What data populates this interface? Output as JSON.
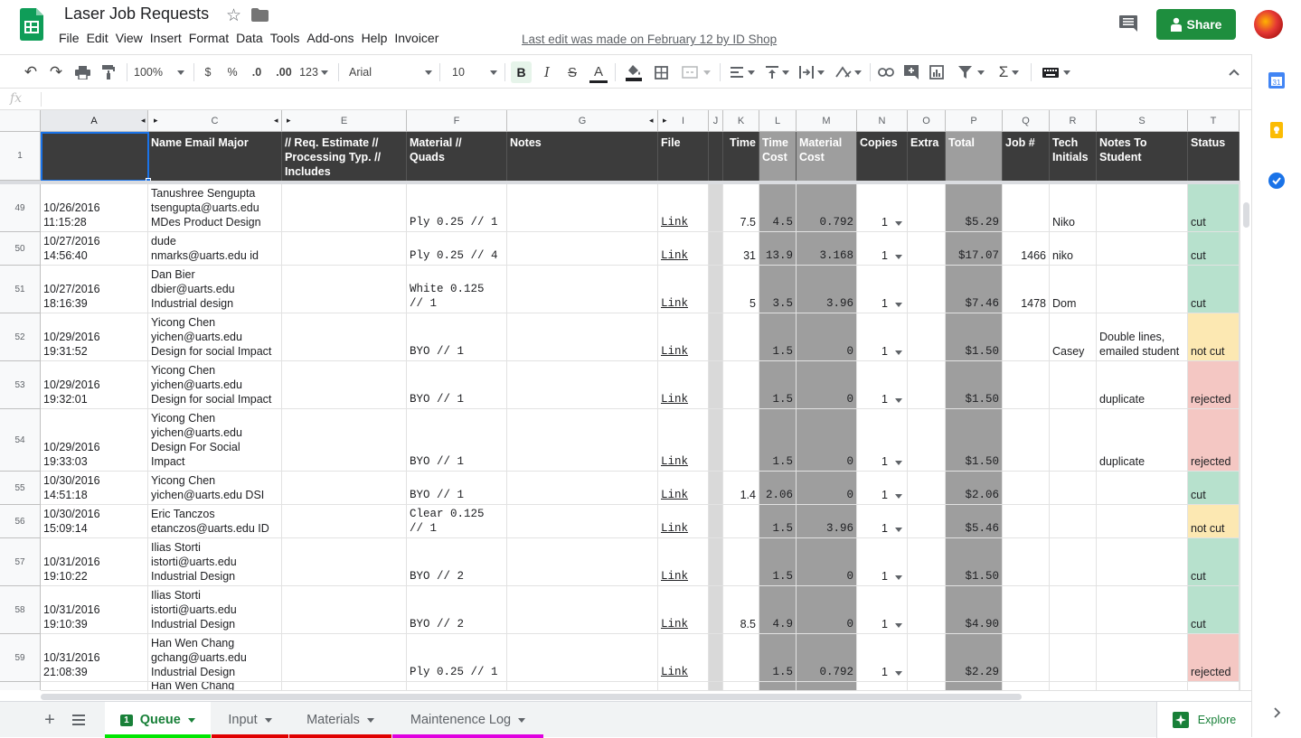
{
  "app": {
    "title": "Laser Job Requests",
    "last_edit": "Last edit was made on February 12 by ID Shop",
    "share_label": "Share",
    "accent": "#1e8e3e"
  },
  "menu": [
    "File",
    "Edit",
    "View",
    "Insert",
    "Format",
    "Data",
    "Tools",
    "Add-ons",
    "Help",
    "Invoicer"
  ],
  "toolbar": {
    "zoom": "100%",
    "currency": "$",
    "percent": "%",
    "dec_less": ".0",
    "dec_more": ".00",
    "more_formats": "123",
    "font": "Arial",
    "font_size": "10",
    "bold": "B",
    "italic": "I",
    "strike": "S",
    "text_color": "A"
  },
  "formula_bar": {
    "fx": "fx"
  },
  "columns": [
    {
      "letter": "A",
      "header": ""
    },
    {
      "letter": "C",
      "header": "Name Email Major"
    },
    {
      "letter": "E",
      "header": "// Req. Estimate //\nProcessing Typ. //\nIncludes"
    },
    {
      "letter": "F",
      "header": "Material //\nQuads"
    },
    {
      "letter": "G",
      "header": "Notes"
    },
    {
      "letter": "I",
      "header": "File"
    },
    {
      "letter": "J",
      "header": ""
    },
    {
      "letter": "K",
      "header": "Time"
    },
    {
      "letter": "L",
      "header": "Time\nCost"
    },
    {
      "letter": "M",
      "header": "Material\nCost"
    },
    {
      "letter": "N",
      "header": "Copies"
    },
    {
      "letter": "O",
      "header": "Extra"
    },
    {
      "letter": "P",
      "header": "Total"
    },
    {
      "letter": "Q",
      "header": "Job #"
    },
    {
      "letter": "R",
      "header": "Tech\nInitials"
    },
    {
      "letter": "S",
      "header": "Notes To\nStudent"
    },
    {
      "letter": "T",
      "header": "Status"
    }
  ],
  "header_row_number": "1",
  "rows": [
    {
      "num": "49",
      "date": "10/26/2016 11:15:28",
      "name": "Tanushree Sengupta\ntsengupta@uarts.edu\nMDes Product Design",
      "material": "Ply 0.25 // 1",
      "file": "Link",
      "time": "7.5",
      "time_cost": "4.5",
      "mat_cost": "0.792",
      "copies": "1",
      "total": "$5.29",
      "job": "",
      "tech": "Niko",
      "notes": "",
      "status": "cut"
    },
    {
      "num": "50",
      "date": "10/27/2016 14:56:40",
      "name": "dude\nnmarks@uarts.edu id",
      "material": "Ply 0.25 // 4",
      "file": "Link",
      "time": "31",
      "time_cost": "13.9",
      "mat_cost": "3.168",
      "copies": "1",
      "total": "$17.07",
      "job": "1466",
      "tech": "niko",
      "notes": "",
      "status": "cut"
    },
    {
      "num": "51",
      "date": "10/27/2016 18:16:39",
      "name": "Dan Bier\ndbier@uarts.edu\nIndustrial design",
      "material": "White 0.125 // 1",
      "file": "Link",
      "time": "5",
      "time_cost": "3.5",
      "mat_cost": "3.96",
      "copies": "1",
      "total": "$7.46",
      "job": "1478",
      "tech": "Dom",
      "notes": "",
      "status": "cut"
    },
    {
      "num": "52",
      "date": "10/29/2016 19:31:52",
      "name": "Yicong Chen\nyichen@uarts.edu\nDesign for social Impact",
      "material": "BYO // 1",
      "file": "Link",
      "time": "",
      "time_cost": "1.5",
      "mat_cost": "0",
      "copies": "1",
      "total": "$1.50",
      "job": "",
      "tech": "Casey",
      "notes": "Double lines,\nemailed student",
      "status": "not cut"
    },
    {
      "num": "53",
      "date": "10/29/2016 19:32:01",
      "name": "Yicong Chen\nyichen@uarts.edu\nDesign for social Impact",
      "material": "BYO // 1",
      "file": "Link",
      "time": "",
      "time_cost": "1.5",
      "mat_cost": "0",
      "copies": "1",
      "total": "$1.50",
      "job": "",
      "tech": "",
      "notes": "duplicate",
      "status": "rejected"
    },
    {
      "num": "54",
      "date": "10/29/2016 19:33:03",
      "name": "Yicong  Chen\nyichen@uarts.edu\nDesign For Social\nImpact",
      "material": "BYO // 1",
      "file": "Link",
      "time": "",
      "time_cost": "1.5",
      "mat_cost": "0",
      "copies": "1",
      "total": "$1.50",
      "job": "",
      "tech": "",
      "notes": "duplicate",
      "status": "rejected"
    },
    {
      "num": "55",
      "date": "10/30/2016 14:51:18",
      "name": "Yicong  Chen\nyichen@uarts.edu DSI",
      "material": "BYO // 1",
      "file": "Link",
      "time": "1.4",
      "time_cost": "2.06",
      "mat_cost": "0",
      "copies": "1",
      "total": "$2.06",
      "job": "",
      "tech": "",
      "notes": "",
      "status": "cut"
    },
    {
      "num": "56",
      "date": "10/30/2016 15:09:14",
      "name": "Eric Tanczos\netanczos@uarts.edu ID",
      "material": "Clear 0.125 // 1",
      "file": "Link",
      "time": "",
      "time_cost": "1.5",
      "mat_cost": "3.96",
      "copies": "1",
      "total": "$5.46",
      "job": "",
      "tech": "",
      "notes": "",
      "status": "not cut"
    },
    {
      "num": "57",
      "date": "10/31/2016 19:10:22",
      "name": "Ilias Storti\nistorti@uarts.edu\nIndustrial Design",
      "material": "BYO // 2",
      "file": "Link",
      "time": "",
      "time_cost": "1.5",
      "mat_cost": "0",
      "copies": "1",
      "total": "$1.50",
      "job": "",
      "tech": "",
      "notes": "",
      "status": "cut"
    },
    {
      "num": "58",
      "date": "10/31/2016 19:10:39",
      "name": "Ilias Storti\nistorti@uarts.edu\nIndustrial Design",
      "material": "BYO // 2",
      "file": "Link",
      "time": "8.5",
      "time_cost": "4.9",
      "mat_cost": "0",
      "copies": "1",
      "total": "$4.90",
      "job": "",
      "tech": "",
      "notes": "",
      "status": "cut"
    },
    {
      "num": "59",
      "date": "10/31/2016 21:08:39",
      "name": "Han Wen Chang\ngchang@uarts.edu\nIndustrial Design",
      "material": "Ply 0.25 // 1",
      "file": "Link",
      "time": "",
      "time_cost": "1.5",
      "mat_cost": "0.792",
      "copies": "1",
      "total": "$2.29",
      "job": "",
      "tech": "",
      "notes": "",
      "status": "rejected"
    },
    {
      "num": "",
      "date": "",
      "name": "Han Wen Chang",
      "material": "",
      "file": "",
      "time": "",
      "time_cost": "",
      "mat_cost": "",
      "copies": "",
      "total": "",
      "job": "",
      "tech": "",
      "notes": "",
      "status": ""
    }
  ],
  "status_colors": {
    "cut": "#b7e1cd",
    "not cut": "#fce8b2",
    "rejected": "#f4c7c3"
  },
  "sheets": [
    {
      "name": "Queue",
      "badge": "1",
      "color": "#00e600"
    },
    {
      "name": "Input",
      "color": "#e00000"
    },
    {
      "name": "Materials",
      "color": "#e00000"
    },
    {
      "name": "Maintenence Log",
      "color": "#e000e0"
    }
  ],
  "explore_label": "Explore"
}
